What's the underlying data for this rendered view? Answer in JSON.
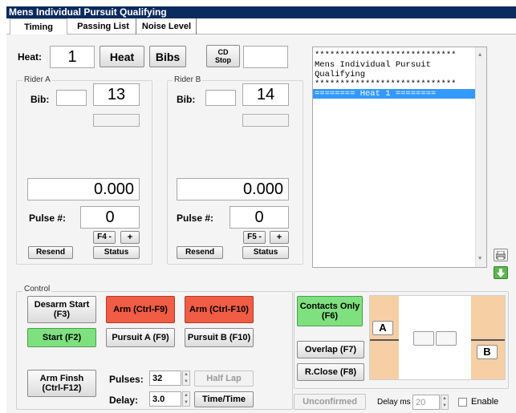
{
  "window": {
    "title": "Mens Individual Pursuit Qualifying"
  },
  "tabs": [
    {
      "label": "Timing"
    },
    {
      "label": "Passing List"
    },
    {
      "label": "Noise Level"
    }
  ],
  "top": {
    "heat_label": "Heat:",
    "heat_value": "1",
    "heat_button": "Heat",
    "bibs_button": "Bibs",
    "cd_stop_button": "CD\nStop",
    "cd_value": ""
  },
  "rider_a": {
    "title": "Rider A",
    "bib_label": "Bib:",
    "bib_input": "",
    "bib_number": "13",
    "time": "0.000",
    "pulse_label": "Pulse #:",
    "pulse_value": "0",
    "minus_button": "F4 -",
    "plus_button": "+",
    "resend_button": "Resend",
    "status_button": "Status"
  },
  "rider_b": {
    "title": "Rider B",
    "bib_label": "Bib:",
    "bib_input": "",
    "bib_number": "14",
    "time": "0.000",
    "pulse_label": "Pulse #:",
    "pulse_value": "0",
    "minus_button": "F5 -",
    "plus_button": "+",
    "resend_button": "Resend",
    "status_button": "Status"
  },
  "log": {
    "lines": [
      "****************************",
      "Mens Individual Pursuit",
      "Qualifying",
      "****************************",
      "======== Heat 1 ========"
    ],
    "selected_index": 4
  },
  "control": {
    "title": "Control",
    "desarm_start": "Desarm Start\n(F3)",
    "arm_ctrl_f9": "Arm (Ctrl-F9)",
    "arm_ctrl_f10": "Arm (Ctrl-F10)",
    "start": "Start (F2)",
    "pursuit_a": "Pursuit A (F9)",
    "pursuit_b": "Pursuit B (F10)",
    "arm_finish": "Arm Finsh\n(Ctrl-F12)",
    "pulses_label": "Pulses:",
    "pulses_value": "32",
    "half_lap": "Half Lap",
    "delay_label": "Delay:",
    "delay_value": "3.0",
    "time_time": "Time/Time",
    "contacts_only": "Contacts Only\n(F6)",
    "overlap": "Overlap (F7)",
    "r_close": "R.Close (F8)",
    "unconfirmed": "Unconfirmed",
    "delay_ms_label": "Delay ms",
    "delay_ms_value": "20",
    "enable_label": "Enable",
    "track_a": "A",
    "track_b": "B"
  },
  "colors": {
    "title_bar": "#0b2a5e",
    "arm_red": "#f05c44",
    "start_green": "#7fe07f",
    "track_orange": "#f7cfa5",
    "selection_blue": "#3399ff"
  }
}
